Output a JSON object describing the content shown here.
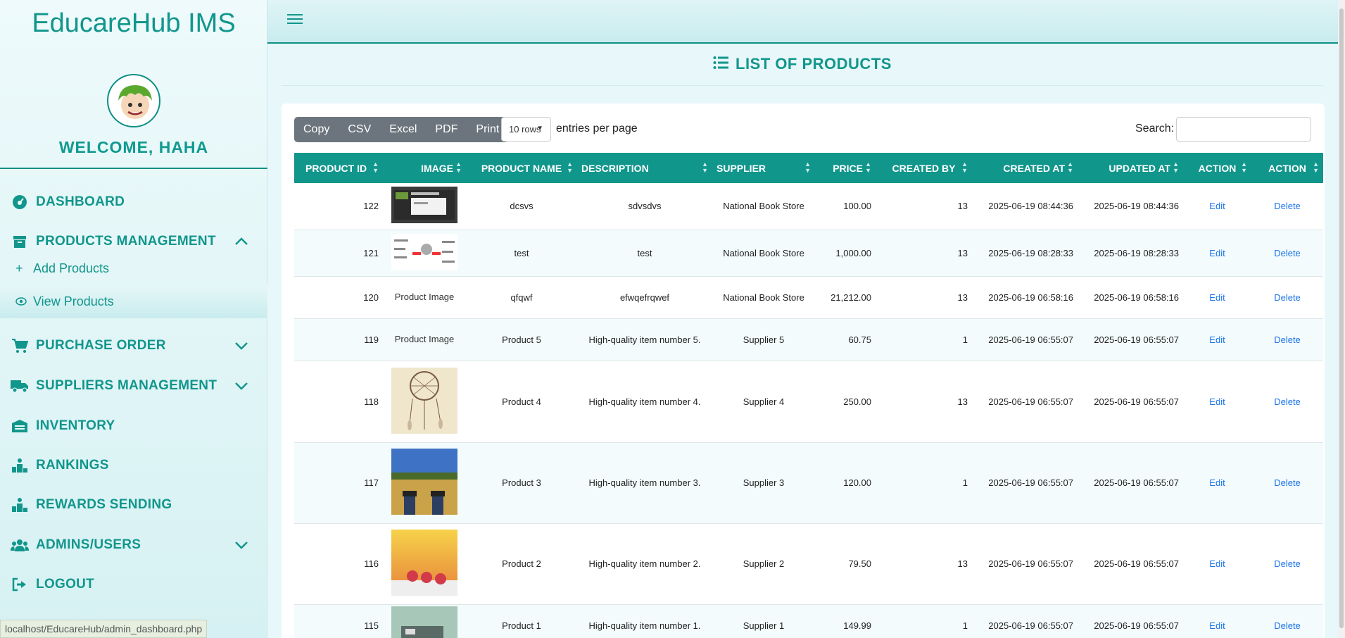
{
  "sidebar": {
    "brand": "EducareHub IMS",
    "welcome": "WELCOME, HAHA",
    "nav": {
      "dashboard": "DASHBOARD",
      "products": "PRODUCTS MANAGEMENT",
      "add_products": "Add Products",
      "view_products": "View Products",
      "purchase_order": "PURCHASE ORDER",
      "suppliers": "SUPPLIERS MANAGEMENT",
      "inventory": "INVENTORY",
      "rankings": "RANKINGS",
      "rewards": "REWARDS SENDING",
      "admins": "ADMINS/USERS",
      "logout": "LOGOUT"
    }
  },
  "status_url": "localhost/EducareHub/admin_dashboard.php",
  "page": {
    "title": "LIST OF PRODUCTS",
    "buttons": {
      "copy": "Copy",
      "csv": "CSV",
      "excel": "Excel",
      "pdf": "PDF",
      "print": "Print"
    },
    "rows_select": "10 rows",
    "entries_label": "entries per page",
    "search_label": "Search:",
    "search_value": ""
  },
  "table": {
    "headers": [
      "PRODUCT ID",
      "IMAGE",
      "PRODUCT NAME",
      "DESCRIPTION",
      "SUPPLIER",
      "PRICE",
      "CREATED BY",
      "CREATED AT",
      "UPDATED AT",
      "ACTION",
      "ACTION"
    ],
    "broken_image_alt": "Product Image",
    "rows": [
      {
        "id": "122",
        "image": "screenshot",
        "name": "dcsvs",
        "description": "sdvsdvs",
        "supplier": "National Book Store",
        "price": "100.00",
        "created_by": "13",
        "created_at": "2025-06-19 08:44:36",
        "updated_at": "2025-06-19 08:44:36",
        "edit": "Edit",
        "delete": "Delete"
      },
      {
        "id": "121",
        "image": "diagram",
        "name": "test",
        "description": "test",
        "supplier": "National Book Store",
        "price": "1,000.00",
        "created_by": "13",
        "created_at": "2025-06-19 08:28:33",
        "updated_at": "2025-06-19 08:28:33",
        "edit": "Edit",
        "delete": "Delete"
      },
      {
        "id": "120",
        "image": "broken",
        "name": "qfqwf",
        "description": "efwqefrqwef",
        "supplier": "National Book Store",
        "price": "21,212.00",
        "created_by": "13",
        "created_at": "2025-06-19 06:58:16",
        "updated_at": "2025-06-19 06:58:16",
        "edit": "Edit",
        "delete": "Delete"
      },
      {
        "id": "119",
        "image": "broken",
        "name": "Product 5",
        "description": "High-quality item number 5.",
        "supplier": "Supplier 5",
        "price": "60.75",
        "created_by": "1",
        "created_at": "2025-06-19 06:55:07",
        "updated_at": "2025-06-19 06:55:07",
        "edit": "Edit",
        "delete": "Delete"
      },
      {
        "id": "118",
        "image": "dreamcatcher",
        "name": "Product 4",
        "description": "High-quality item number 4.",
        "supplier": "Supplier 4",
        "price": "250.00",
        "created_by": "13",
        "created_at": "2025-06-19 06:55:07",
        "updated_at": "2025-06-19 06:55:07",
        "edit": "Edit",
        "delete": "Delete"
      },
      {
        "id": "117",
        "image": "field",
        "name": "Product 3",
        "description": "High-quality item number 3.",
        "supplier": "Supplier 3",
        "price": "120.00",
        "created_by": "1",
        "created_at": "2025-06-19 06:55:07",
        "updated_at": "2025-06-19 06:55:07",
        "edit": "Edit",
        "delete": "Delete"
      },
      {
        "id": "116",
        "image": "berries",
        "name": "Product 2",
        "description": "High-quality item number 2.",
        "supplier": "Supplier 2",
        "price": "79.50",
        "created_by": "13",
        "created_at": "2025-06-19 06:55:07",
        "updated_at": "2025-06-19 06:55:07",
        "edit": "Edit",
        "delete": "Delete"
      },
      {
        "id": "115",
        "image": "truck",
        "name": "Product 1",
        "description": "High-quality item number 1.",
        "supplier": "Supplier 1",
        "price": "149.99",
        "created_by": "1",
        "created_at": "2025-06-19 06:55:07",
        "updated_at": "2025-06-19 06:55:07",
        "edit": "Edit",
        "delete": "Delete"
      }
    ]
  },
  "colors": {
    "accent": "#11968c",
    "link": "#1a73e8",
    "button_group": "#6c757d"
  }
}
